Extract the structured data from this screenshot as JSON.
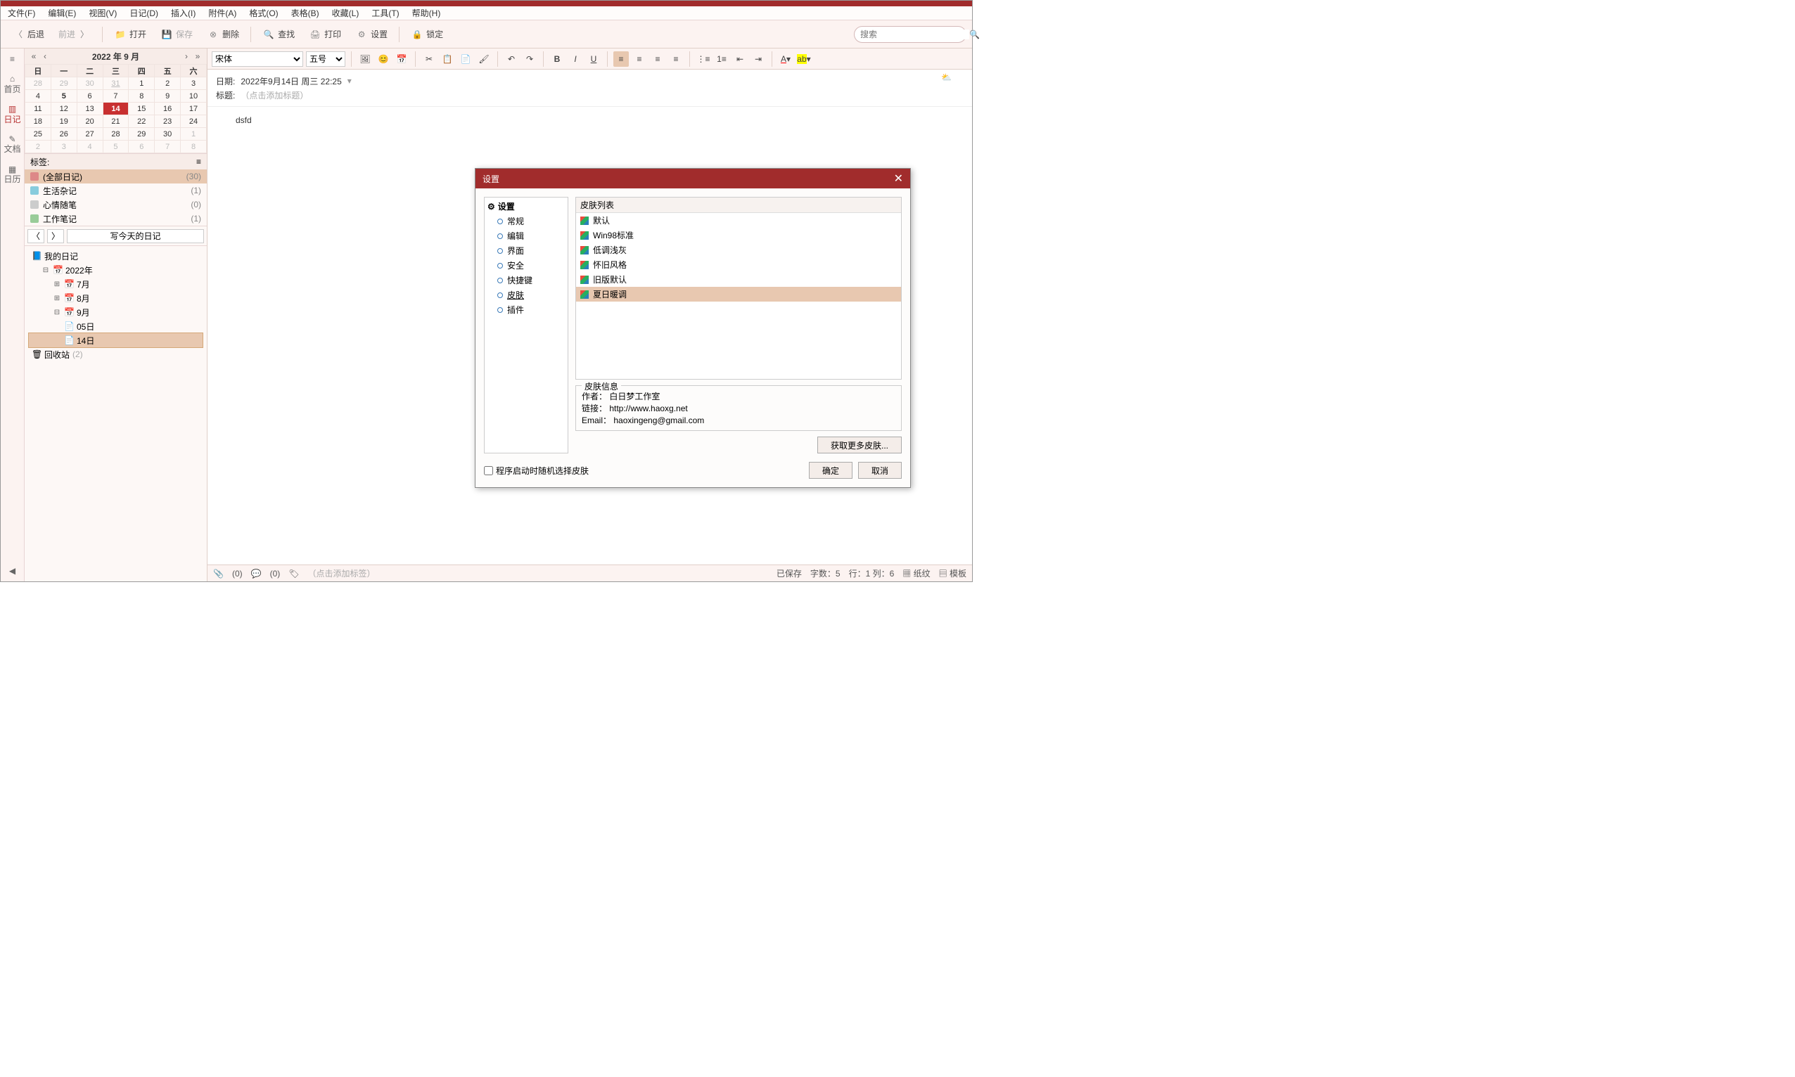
{
  "menu": {
    "file": "文件(F)",
    "edit": "编辑(E)",
    "view": "视图(V)",
    "diary": "日记(D)",
    "insert": "插入(I)",
    "attach": "附件(A)",
    "format": "格式(O)",
    "table": "表格(B)",
    "favorite": "收藏(L)",
    "tools": "工具(T)",
    "help": "帮助(H)"
  },
  "toolbar": {
    "back": "后退",
    "forward": "前进",
    "open": "打开",
    "save": "保存",
    "delete": "删除",
    "find": "查找",
    "print": "打印",
    "settings": "设置",
    "lock": "锁定",
    "search_ph": "搜索"
  },
  "sidetabs": {
    "home": "首页",
    "diary": "日记",
    "doc": "文档",
    "calendar": "日历"
  },
  "calendar": {
    "title": "2022 年 9 月",
    "dow": [
      "日",
      "一",
      "二",
      "三",
      "四",
      "五",
      "六"
    ],
    "rows": [
      [
        {
          "d": "28",
          "o": 1
        },
        {
          "d": "29",
          "o": 1
        },
        {
          "d": "30",
          "o": 1
        },
        {
          "d": "31",
          "o": 1,
          "u": 1
        },
        {
          "d": "1"
        },
        {
          "d": "2"
        },
        {
          "d": "3"
        }
      ],
      [
        {
          "d": "4"
        },
        {
          "d": "5",
          "h": 1
        },
        {
          "d": "6"
        },
        {
          "d": "7"
        },
        {
          "d": "8"
        },
        {
          "d": "9"
        },
        {
          "d": "10"
        }
      ],
      [
        {
          "d": "11"
        },
        {
          "d": "12"
        },
        {
          "d": "13"
        },
        {
          "d": "14",
          "t": 1
        },
        {
          "d": "15"
        },
        {
          "d": "16"
        },
        {
          "d": "17"
        }
      ],
      [
        {
          "d": "18"
        },
        {
          "d": "19"
        },
        {
          "d": "20"
        },
        {
          "d": "21"
        },
        {
          "d": "22"
        },
        {
          "d": "23"
        },
        {
          "d": "24"
        }
      ],
      [
        {
          "d": "25"
        },
        {
          "d": "26"
        },
        {
          "d": "27"
        },
        {
          "d": "28"
        },
        {
          "d": "29"
        },
        {
          "d": "30"
        },
        {
          "d": "1",
          "o": 1
        }
      ],
      [
        {
          "d": "2",
          "o": 1
        },
        {
          "d": "3",
          "o": 1
        },
        {
          "d": "4",
          "o": 1
        },
        {
          "d": "5",
          "o": 1
        },
        {
          "d": "6",
          "o": 1
        },
        {
          "d": "7",
          "o": 1
        },
        {
          "d": "8",
          "o": 1
        }
      ]
    ]
  },
  "tags": {
    "label": "标签:",
    "items": [
      {
        "name": "(全部日记)",
        "count": "(30)",
        "sel": true,
        "color": "#d88"
      },
      {
        "name": "生活杂记",
        "count": "(1)",
        "color": "#8cd"
      },
      {
        "name": "心情随笔",
        "count": "(0)",
        "color": "#ccc"
      },
      {
        "name": "工作笔记",
        "count": "(1)",
        "color": "#9c9"
      }
    ],
    "today_btn": "写今天的日记"
  },
  "tree": {
    "root": "我的日记",
    "year": "2022年",
    "months": [
      {
        "m": "7月"
      },
      {
        "m": "8月"
      },
      {
        "m": "9月",
        "open": true,
        "days": [
          {
            "d": "05日"
          },
          {
            "d": "14日",
            "sel": true
          }
        ]
      }
    ],
    "trash": "回收站",
    "trash_cnt": "(2)"
  },
  "format": {
    "font": "宋体",
    "size": "五号"
  },
  "meta": {
    "date_lbl": "日期:",
    "date": "2022年9月14日  周三  22:25",
    "title_lbl": "标题:",
    "title_ph": "（点击添加标题）"
  },
  "content": "dsfd",
  "status": {
    "att": "(0)",
    "cmt": "(0)",
    "tag_ph": "（点击添加标签）",
    "saved": "已保存",
    "wc": "字数：5",
    "pos": "行：1  列：6",
    "paper": "纸纹",
    "tpl": "模板"
  },
  "dialog": {
    "title": "设置",
    "tree_root": "设置",
    "tree": [
      "常规",
      "编辑",
      "界面",
      "安全",
      "快捷键",
      "皮肤",
      "插件"
    ],
    "tree_sel": "皮肤",
    "list_title": "皮肤列表",
    "skins": [
      "默认",
      "Win98标准",
      "低调浅灰",
      "怀旧风格",
      "旧版默认",
      "夏日暖调"
    ],
    "skin_sel": "夏日暖调",
    "info_title": "皮肤信息",
    "info_author": "作者： 白日梦工作室",
    "info_link": "链接： http://www.haoxg.net",
    "info_email": "Email： haoxingeng@gmail.com",
    "chk": "程序启动时随机选择皮肤",
    "more": "获取更多皮肤...",
    "ok": "确定",
    "cancel": "取消"
  }
}
